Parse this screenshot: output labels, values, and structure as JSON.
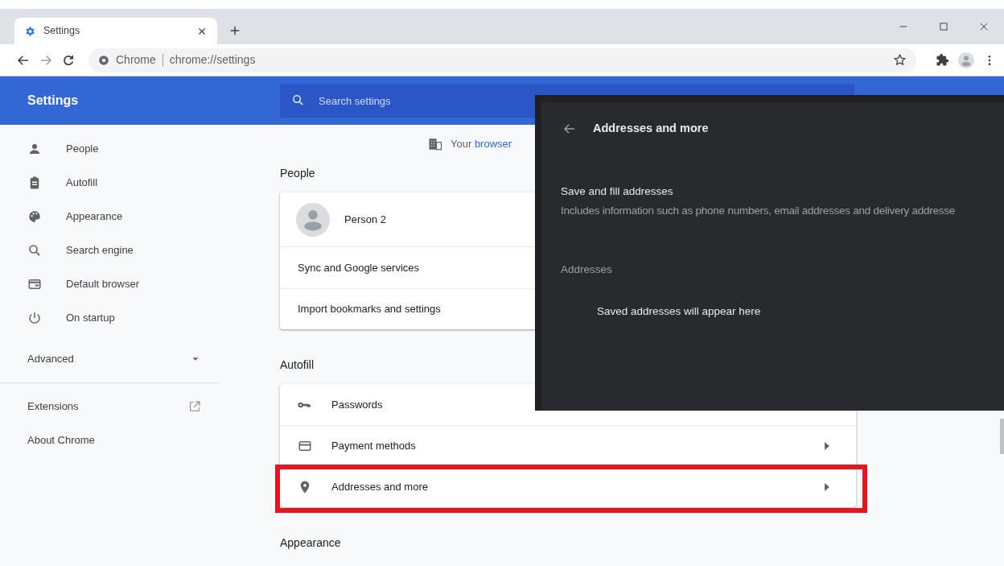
{
  "window": {
    "tabs": [
      {
        "title": "Settings",
        "selected": true
      }
    ],
    "address": {
      "origin": "Chrome",
      "url": "chrome://settings"
    }
  },
  "header": {
    "title": "Settings",
    "search": {
      "placeholder": "Search settings"
    }
  },
  "sidebar": {
    "items": [
      {
        "label": "People",
        "selected": false
      },
      {
        "label": "Autofill",
        "selected": false
      },
      {
        "label": "Appearance",
        "selected": false
      },
      {
        "label": "Search engine",
        "selected": false
      },
      {
        "label": "Default browser",
        "selected": false
      },
      {
        "label": "On startup",
        "selected": false
      }
    ],
    "advanced": {
      "label": "Advanced",
      "expanded": false
    },
    "links": [
      {
        "label": "Extensions",
        "kind": "external"
      },
      {
        "label": "About Chrome",
        "kind": "plain"
      }
    ]
  },
  "main": {
    "managed_notice": {
      "text": "Your ",
      "link": "browser"
    },
    "sections": [
      {
        "title": "People",
        "profile": {
          "name": "Person 2"
        },
        "rows": [
          {
            "label": "Sync and Google services",
            "highlighted": false
          },
          {
            "label": "Import bookmarks and settings",
            "highlighted": false
          }
        ]
      },
      {
        "title": "Autofill",
        "rows": [
          {
            "label": "Passwords",
            "highlighted": false,
            "chevron": false
          },
          {
            "label": "Payment methods",
            "highlighted": false,
            "chevron": true
          },
          {
            "label": "Addresses and more",
            "highlighted": true,
            "chevron": true
          }
        ]
      },
      {
        "title": "Appearance"
      }
    ]
  },
  "overlay": {
    "title": "Addresses and more",
    "setting": {
      "title": "Save and fill addresses",
      "description": "Includes information such as phone numbers, email addresses and delivery addresse"
    },
    "section": "Addresses",
    "empty_text": "Saved addresses will appear here"
  }
}
